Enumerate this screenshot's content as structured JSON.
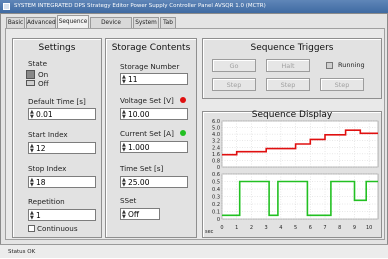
{
  "window": {
    "title": "SYSTEM INTEGRATED DPS Strategy Editor Power Supply Controller Panel AVSQR 1.0 (MCTR)"
  },
  "tabs": [
    {
      "label": "Basic",
      "active": false
    },
    {
      "label": "Advanced",
      "active": false
    },
    {
      "label": "Sequence",
      "active": true
    },
    {
      "label": "Device Config",
      "active": false
    },
    {
      "label": "System",
      "active": false
    },
    {
      "label": "Tab",
      "active": false
    }
  ],
  "settings": {
    "title": "Settings",
    "state_label": "State",
    "state_on": "On",
    "state_off": "Off",
    "default_time_label": "Default Time [s]",
    "default_time_value": "0.01",
    "start_index_label": "Start Index",
    "start_index_value": "12",
    "stop_index_label": "Stop Index",
    "stop_index_value": "18",
    "repetition_label": "Repetition",
    "repetition_value": "1",
    "continuous_label": "Continuous"
  },
  "storage": {
    "title": "Storage Contents",
    "storage_number_label": "Storage Number",
    "storage_number_value": "11",
    "voltage_label": "Voltage Set [V]",
    "voltage_value": "10.00",
    "voltage_color": "#e01010",
    "current_label": "Current Set [A]",
    "current_value": "1.000",
    "current_color": "#22c022",
    "time_label": "Time Set [s]",
    "time_value": "25.00",
    "sset_label": "SSet",
    "sset_value": "Off"
  },
  "triggers": {
    "title": "Sequence Triggers",
    "go_label": "Go",
    "halt_label": "Halt",
    "running_label": "Running",
    "step1_label": "Step",
    "step2_label": "Step",
    "step3_label": "Step"
  },
  "display": {
    "title": "Sequence Display"
  },
  "chart_data": {
    "type": "line",
    "title": "Sequence Display",
    "x_ticks": [
      "0",
      "1",
      "2",
      "3",
      "4",
      "5",
      "6",
      "7",
      "8",
      "9",
      "10"
    ],
    "xlim": [
      0,
      10.6
    ],
    "top_axis": {
      "ticks": [
        "6.0",
        "5.0",
        "4.0",
        "3.2",
        "2.4",
        "1.6",
        "0.8",
        "0"
      ],
      "ylim": [
        0,
        6.0
      ]
    },
    "bottom_axis": {
      "ticks": [
        "0.6",
        "0.5",
        "0.4",
        "0.3",
        "0.2",
        "0.1",
        "0"
      ],
      "ylim": [
        0,
        0.6
      ]
    },
    "series": [
      {
        "axis": "top",
        "color": "#e01010",
        "x": [
          0,
          1,
          1,
          3,
          3,
          5,
          5,
          6,
          6,
          7,
          7,
          8.4,
          8.4,
          9.4,
          9.4,
          10.6
        ],
        "values": [
          1.6,
          1.6,
          2.0,
          2.0,
          2.4,
          2.4,
          3.0,
          3.0,
          3.6,
          3.6,
          4.2,
          4.2,
          4.8,
          4.8,
          4.4,
          4.4
        ]
      },
      {
        "axis": "bottom",
        "color": "#22c022",
        "x": [
          0,
          1.2,
          1.2,
          3.2,
          3.2,
          3.8,
          3.8,
          5.8,
          5.8,
          7.4,
          7.4,
          9.0,
          9.0,
          9.8,
          9.8,
          10.6
        ],
        "values": [
          0.05,
          0.05,
          0.5,
          0.5,
          0.05,
          0.05,
          0.5,
          0.5,
          0.05,
          0.05,
          0.5,
          0.5,
          0.25,
          0.25,
          0.5,
          0.5
        ]
      }
    ]
  },
  "chart_corner_label": "sec",
  "status": {
    "text": "Status OK"
  }
}
